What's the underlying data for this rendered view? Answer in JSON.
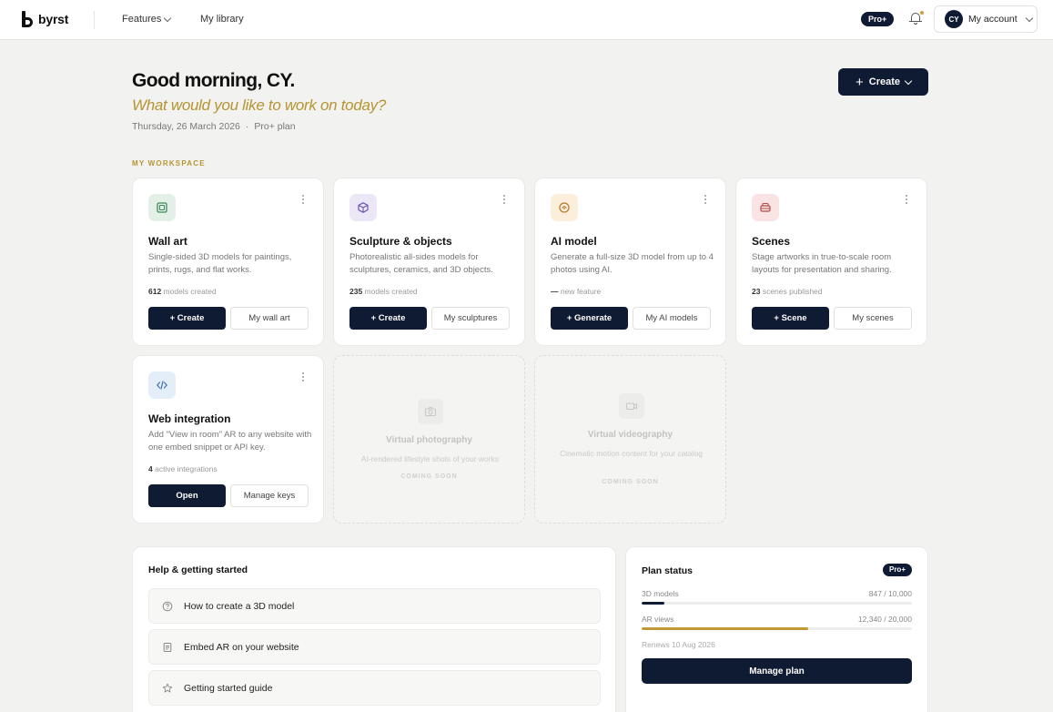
{
  "topbar": {
    "logo": "byrst",
    "nav": [
      {
        "label": "Features"
      },
      {
        "label": "My library"
      }
    ],
    "pro_badge": "Pro+",
    "avatar_initials": "CY",
    "account_label": "My account"
  },
  "header": {
    "greeting": "Good morning, CY.",
    "subtitle": "What would you like to work on today?",
    "date": "Thursday, 26 March 2026",
    "separator": "·",
    "plan": "Pro+ plan",
    "create_label": "Create"
  },
  "workspace": {
    "section_label": "MY WORKSPACE",
    "cards": [
      {
        "title": "Wall art",
        "desc": "Single-sided 3D models for paintings, prints, rugs, and flat works.",
        "stat_value": "612",
        "stat_text": " models created",
        "primary": "+ Create",
        "secondary": "My wall art",
        "icon": "frame-icon",
        "icon_bg": "#e3f0e7",
        "icon_color": "#3f8a5a"
      },
      {
        "title": "Sculpture & objects",
        "desc": "Photorealistic all-sides models for sculptures, ceramics, and 3D objects.",
        "stat_value": "235",
        "stat_text": " models created",
        "primary": "+ Create",
        "secondary": "My sculptures",
        "icon": "cube-icon",
        "icon_bg": "#ebe7f7",
        "icon_color": "#6a55b8"
      },
      {
        "title": "AI model",
        "desc": "Generate a full-size 3D model from up to 4 photos using AI.",
        "stat_value": "—",
        "stat_text": " new feature",
        "primary": "+ Generate",
        "secondary": "My AI models",
        "icon": "sparkle-icon",
        "icon_bg": "#fbeedb",
        "icon_color": "#b7782a"
      },
      {
        "title": "Scenes",
        "desc": "Stage artworks in true-to-scale room layouts for presentation and sharing.",
        "stat_value": "23",
        "stat_text": " scenes published",
        "primary": "+ Scene",
        "secondary": "My scenes",
        "icon": "sofa-icon",
        "icon_bg": "#f9e3e3",
        "icon_color": "#b44a4a"
      },
      {
        "title": "Web integration",
        "desc": "Add \"View in room\" AR to any website with one embed snippet or API key.",
        "stat_value": "4",
        "stat_text": " active integrations",
        "primary": "Open",
        "secondary": "Manage keys",
        "icon": "code-icon",
        "icon_bg": "#e3eef9",
        "icon_color": "#3d6fa8"
      }
    ],
    "coming": [
      {
        "title": "Virtual photography",
        "desc": "AI-rendered lifestyle shots of your works",
        "soon": "COMING SOON",
        "icon": "camera-icon"
      },
      {
        "title": "Virtual videography",
        "desc": "Cinematic motion content for your catalog",
        "soon": "COMING SOON",
        "icon": "video-icon"
      }
    ]
  },
  "help": {
    "title": "Help & getting started",
    "items": [
      {
        "label": "How to create a 3D model",
        "icon": "question-icon"
      },
      {
        "label": "Embed AR on your website",
        "icon": "document-icon"
      },
      {
        "label": "Getting started guide",
        "icon": "star-icon"
      }
    ]
  },
  "plan": {
    "title": "Plan status",
    "badge": "Pro+",
    "meters": [
      {
        "label": "3D models",
        "value": "847 / 10,000",
        "fraction": 0.0847,
        "color": "#0f1a33"
      },
      {
        "label": "AR views",
        "value": "12,340 / 20,000",
        "fraction": 0.617,
        "color": "#c19a35"
      }
    ],
    "renews": "Renews 10 Aug 2026",
    "manage_label": "Manage plan"
  }
}
